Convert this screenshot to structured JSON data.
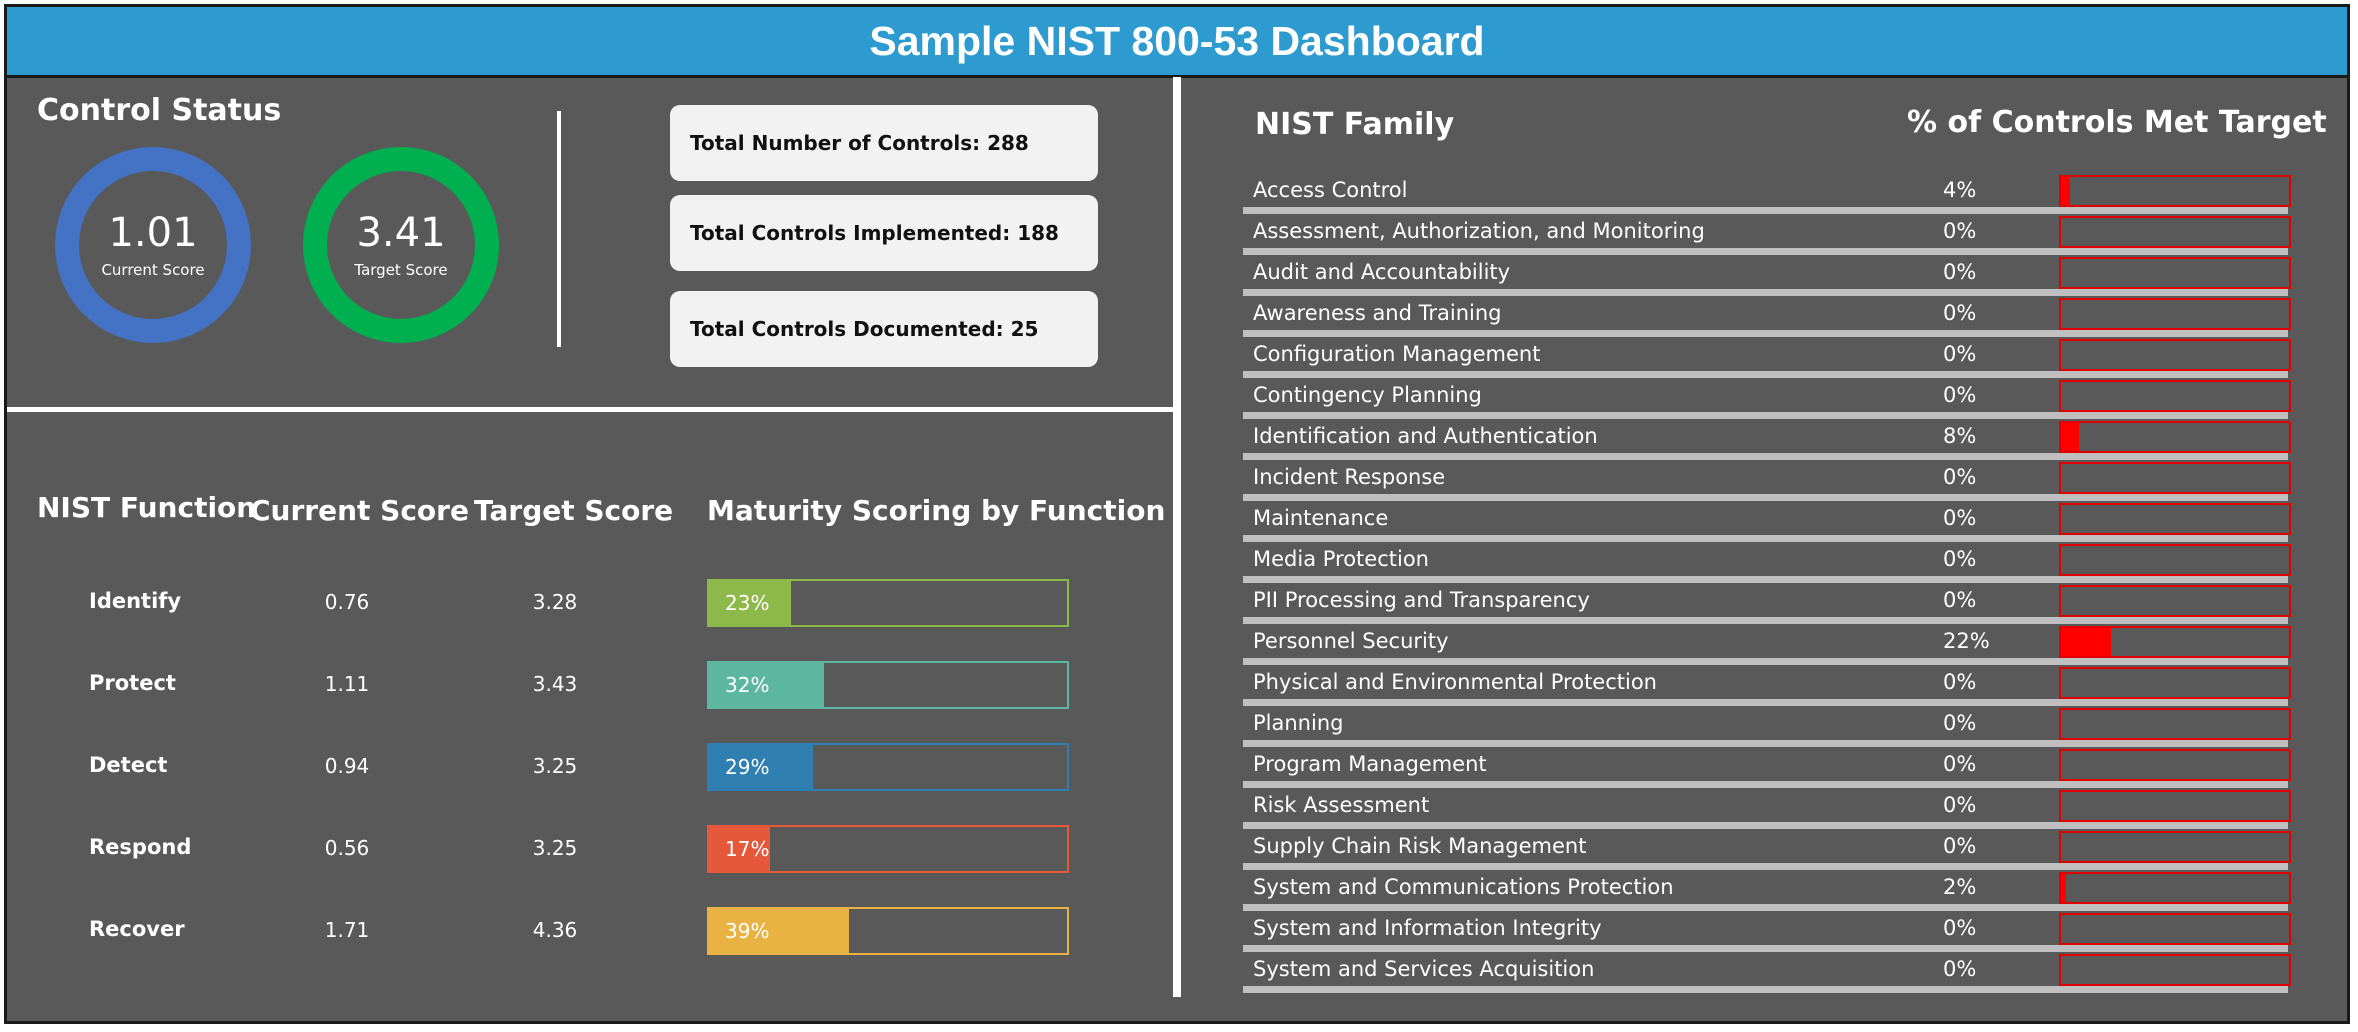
{
  "title": "Sample NIST 800-53 Dashboard",
  "control_status": {
    "title": "Control Status",
    "current": {
      "value": "1.01",
      "label": "Current Score",
      "color": "#4472c4"
    },
    "target": {
      "value": "3.41",
      "label": "Target Score",
      "color": "#00b050"
    },
    "stats": [
      "Total Number of Controls: 288",
      "Total Controls Implemented: 188",
      "Total Controls Documented: 25"
    ]
  },
  "functions": {
    "headers": {
      "name": "NIST Function",
      "current": "Current Score",
      "target": "Target Score",
      "maturity": "Maturity Scoring by Function"
    },
    "rows": [
      {
        "name": "Identify",
        "current": "0.76",
        "target": "3.28",
        "pct_label": "23%",
        "pct": 23,
        "color": "#8db84a"
      },
      {
        "name": "Protect",
        "current": "1.11",
        "target": "3.43",
        "pct_label": "32%",
        "pct": 32,
        "color": "#5db6a0"
      },
      {
        "name": "Detect",
        "current": "0.94",
        "target": "3.25",
        "pct_label": "29%",
        "pct": 29,
        "color": "#2f7fb0"
      },
      {
        "name": "Respond",
        "current": "0.56",
        "target": "3.25",
        "pct_label": "17%",
        "pct": 17,
        "color": "#e5583a"
      },
      {
        "name": "Recover",
        "current": "1.71",
        "target": "4.36",
        "pct_label": "39%",
        "pct": 39,
        "color": "#e9b343"
      }
    ]
  },
  "families": {
    "header_name": "NIST Family",
    "header_pct": "% of Controls Met Target",
    "bar_color": "#ff0000",
    "rows": [
      {
        "name": "Access Control",
        "pct_label": "4%",
        "pct": 4
      },
      {
        "name": "Assessment, Authorization, and Monitoring",
        "pct_label": "0%",
        "pct": 0
      },
      {
        "name": "Audit and Accountability",
        "pct_label": "0%",
        "pct": 0
      },
      {
        "name": "Awareness and Training",
        "pct_label": "0%",
        "pct": 0
      },
      {
        "name": "Configuration Management",
        "pct_label": "0%",
        "pct": 0
      },
      {
        "name": "Contingency Planning",
        "pct_label": "0%",
        "pct": 0
      },
      {
        "name": "Identification and Authentication",
        "pct_label": "8%",
        "pct": 8
      },
      {
        "name": "Incident Response",
        "pct_label": "0%",
        "pct": 0
      },
      {
        "name": "Maintenance",
        "pct_label": "0%",
        "pct": 0
      },
      {
        "name": "Media Protection",
        "pct_label": "0%",
        "pct": 0
      },
      {
        "name": "PII Processing and Transparency",
        "pct_label": "0%",
        "pct": 0
      },
      {
        "name": "Personnel Security",
        "pct_label": "22%",
        "pct": 22
      },
      {
        "name": "Physical and Environmental Protection",
        "pct_label": "0%",
        "pct": 0
      },
      {
        "name": "Planning",
        "pct_label": "0%",
        "pct": 0
      },
      {
        "name": "Program Management",
        "pct_label": "0%",
        "pct": 0
      },
      {
        "name": "Risk Assessment",
        "pct_label": "0%",
        "pct": 0
      },
      {
        "name": "Supply Chain Risk Management",
        "pct_label": "0%",
        "pct": 0
      },
      {
        "name": "System and Communications Protection",
        "pct_label": "2%",
        "pct": 2
      },
      {
        "name": "System and Information Integrity",
        "pct_label": "0%",
        "pct": 0
      },
      {
        "name": "System and Services Acquisition",
        "pct_label": "0%",
        "pct": 0
      }
    ]
  }
}
